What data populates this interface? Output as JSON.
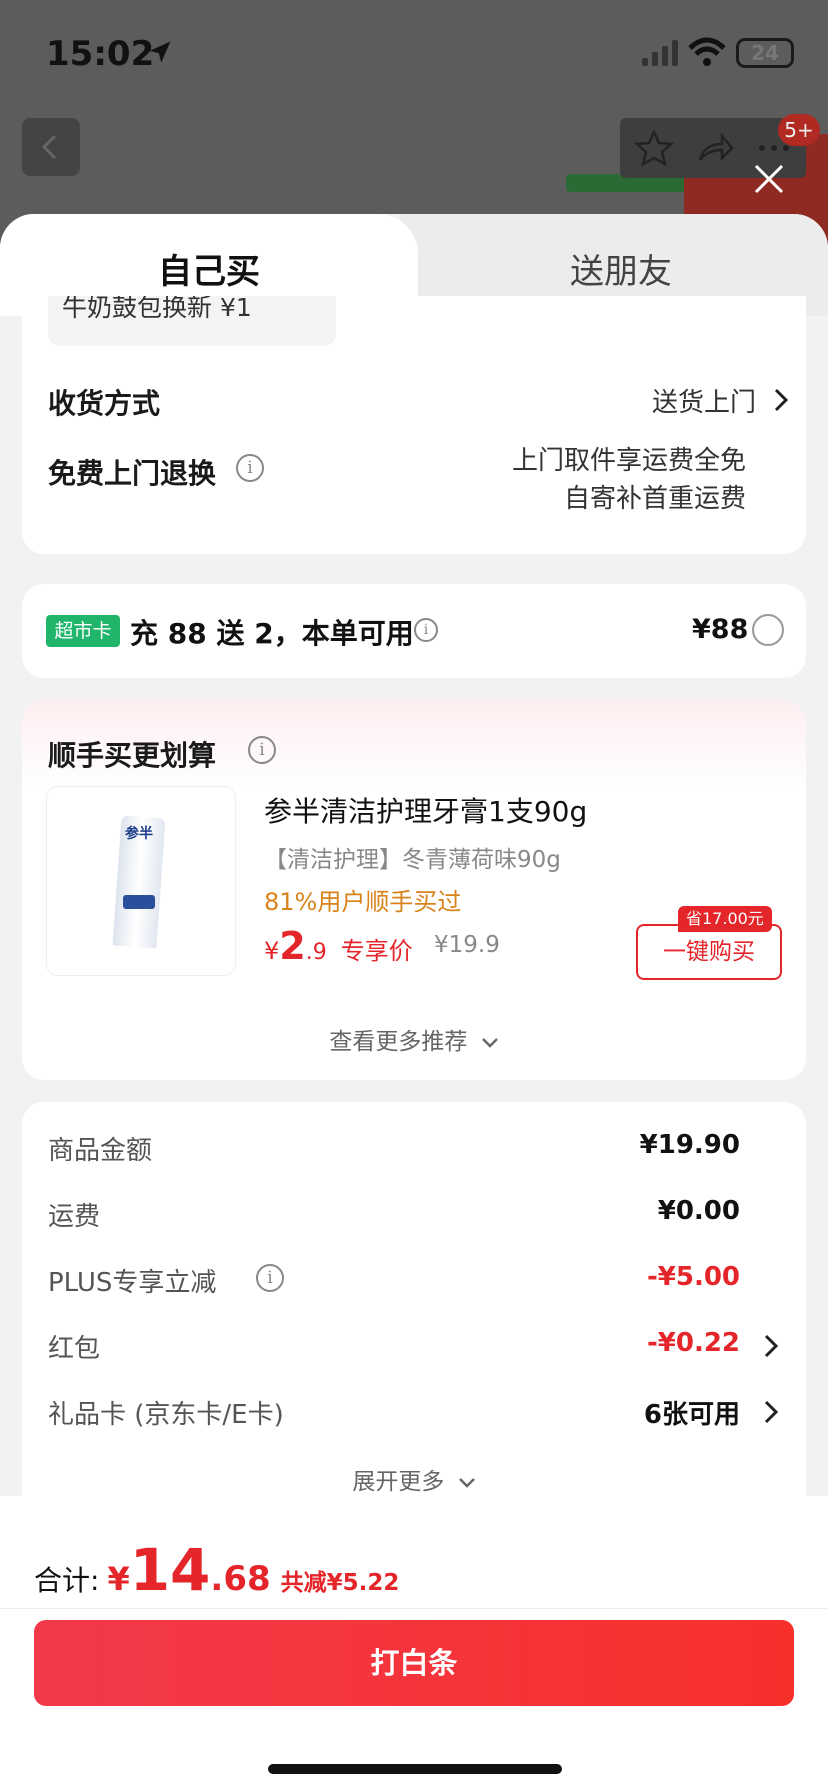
{
  "status_bar": {
    "time": "15:02",
    "battery": "24"
  },
  "background_page": {
    "notification_badge": "5+"
  },
  "tabs": {
    "self_buy": "自己买",
    "gift": "送朋友"
  },
  "delivery": {
    "prev_item_text": "牛奶鼓包换新     ¥1",
    "method_label": "收货方式",
    "method_value": "送货上门",
    "return_label": "免费上门退换",
    "return_line1": "上门取件享运费全免",
    "return_line2": "自寄补首重运费"
  },
  "supermarket_card": {
    "tag": "超市卡",
    "text": "充 88 送 2，本单可用",
    "price": "¥88"
  },
  "addon": {
    "title": "顺手买更划算",
    "product_name": "参半清洁护理牙膏1支90g",
    "product_spec": "【清洁护理】冬青薄荷味90g",
    "social_proof": "81%用户顺手买过",
    "price_symbol": "¥",
    "price_int": "2",
    "price_dec": ".9",
    "price_tag": "专享价",
    "original_price": "¥19.9",
    "save_badge": "省17.00元",
    "buy_button": "一键购买",
    "more_recommendations": "查看更多推荐",
    "brand_on_pack": "参半"
  },
  "summary": {
    "rows": [
      {
        "label": "商品金额",
        "value": "¥19.90"
      },
      {
        "label": "运费",
        "value": "¥0.00"
      },
      {
        "label": "PLUS专享立减",
        "value": "-¥5.00"
      },
      {
        "label": "红包",
        "value": "-¥0.22"
      },
      {
        "label": "礼品卡 (京东卡/E卡)",
        "value": "6张可用"
      }
    ],
    "expand_more": "展开更多"
  },
  "footer": {
    "total_label": "合计:",
    "total_symbol": "¥",
    "total_int": "14",
    "total_dec": ".68",
    "total_discount": "共减¥5.22",
    "pay_button": "打白条"
  },
  "colors": {
    "accent_red": "#e4262b",
    "supercard_green": "#21b56b",
    "social_orange": "#d9831a"
  }
}
